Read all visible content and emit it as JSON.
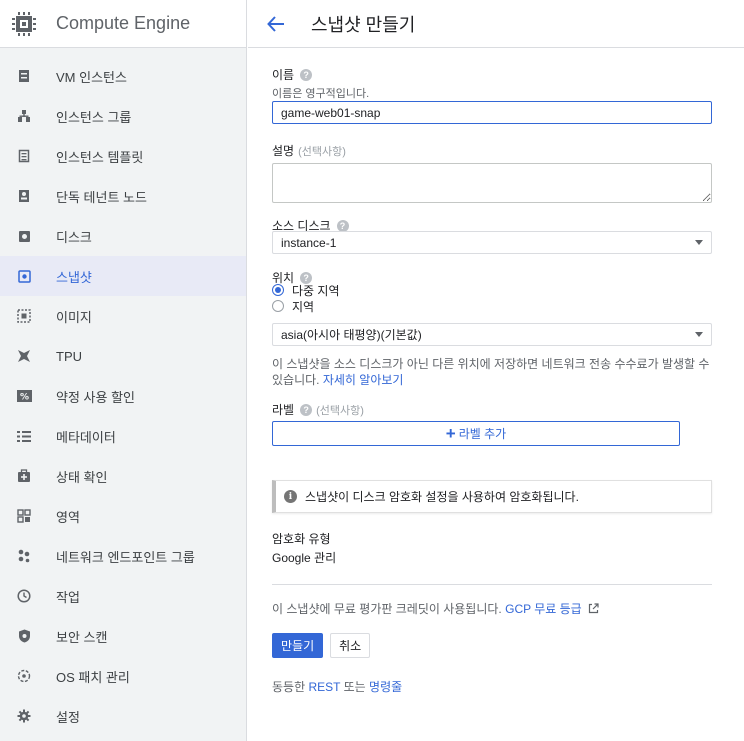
{
  "app": {
    "title": "Compute Engine"
  },
  "sidebar": {
    "items": [
      {
        "label": "VM 인스턴스",
        "icon": "vm-instance-icon",
        "active": false
      },
      {
        "label": "인스턴스 그룹",
        "icon": "instance-group-icon",
        "active": false
      },
      {
        "label": "인스턴스 템플릿",
        "icon": "instance-template-icon",
        "active": false
      },
      {
        "label": "단독 테넌트 노드",
        "icon": "sole-tenant-icon",
        "active": false
      },
      {
        "label": "디스크",
        "icon": "disk-icon",
        "active": false
      },
      {
        "label": "스냅샷",
        "icon": "snapshot-icon",
        "active": true
      },
      {
        "label": "이미지",
        "icon": "image-icon",
        "active": false
      },
      {
        "label": "TPU",
        "icon": "tpu-icon",
        "active": false
      },
      {
        "label": "약정 사용 할인",
        "icon": "percent-icon",
        "active": false
      },
      {
        "label": "메타데이터",
        "icon": "metadata-icon",
        "active": false
      },
      {
        "label": "상태 확인",
        "icon": "health-check-icon",
        "active": false
      },
      {
        "label": "영역",
        "icon": "zone-icon",
        "active": false
      },
      {
        "label": "네트워크 엔드포인트 그룹",
        "icon": "network-endpoint-icon",
        "active": false
      },
      {
        "label": "작업",
        "icon": "clock-icon",
        "active": false
      },
      {
        "label": "보안 스캔",
        "icon": "shield-icon",
        "active": false
      },
      {
        "label": "OS 패치 관리",
        "icon": "os-patch-icon",
        "active": false
      },
      {
        "label": "설정",
        "icon": "gear-icon",
        "active": false
      }
    ]
  },
  "header": {
    "title": "스냅샷 만들기"
  },
  "form": {
    "name": {
      "label": "이름",
      "hint": "이름은 영구적입니다.",
      "value": "game-web01-snap"
    },
    "description": {
      "label": "설명",
      "optional": "(선택사항)"
    },
    "source_disk": {
      "label": "소스 디스크",
      "value": "instance-1"
    },
    "location": {
      "label": "위치",
      "options": [
        {
          "label": "다중 지역",
          "checked": true
        },
        {
          "label": "지역",
          "checked": false
        }
      ],
      "region_value": "asia(아시아 태평양)(기본값)",
      "info": "이 스냅샷을 소스 디스크가 아닌 다른 위치에 저장하면 네트워크 전송 수수료가 발생할 수 있습니다.",
      "learn_more": "자세히 알아보기"
    },
    "labels": {
      "label": "라벨",
      "optional": "(선택사항)",
      "add_button": "라벨 추가"
    },
    "notice": "스냅샷이 디스크 암호화 설정을 사용하여 암호화됩니다.",
    "encryption": {
      "label": "암호화 유형",
      "value": "Google 관리"
    },
    "credit": {
      "text": "이 스냅샷에 무료 평가판 크레딧이 사용됩니다.",
      "link": "GCP 무료 등급"
    },
    "buttons": {
      "create": "만들기",
      "cancel": "취소"
    },
    "equivalent": {
      "prefix": "동등한",
      "rest": "REST",
      "middle": "또는",
      "command": "명령줄"
    }
  },
  "colors": {
    "accent": "#3367d6",
    "sidebar_bg": "#f1f3f4",
    "active_bg": "#e8eaf6"
  }
}
